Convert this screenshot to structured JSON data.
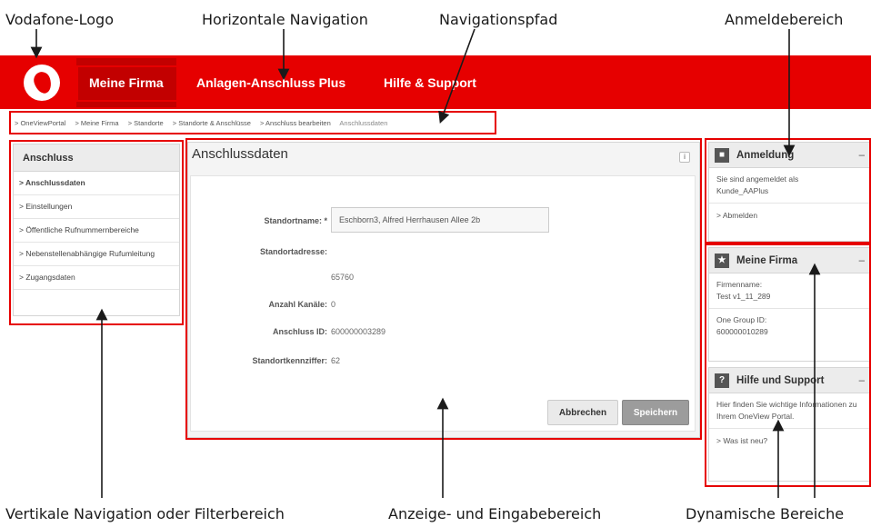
{
  "annotations": {
    "logo": "Vodafone-Logo",
    "horizontal_nav": "Horizontale Navigation",
    "breadcrumb": "Navigationspfad",
    "login_area": "Anmeldebereich",
    "vertical_nav": "Vertikale Navigation oder Filterbereich",
    "display_area": "Anzeige- und Eingabebereich",
    "dynamic_areas": "Dynamische Bereiche"
  },
  "header": {
    "nav": [
      "Meine Firma",
      "Anlagen-Anschluss Plus",
      "Hilfe & Support"
    ]
  },
  "breadcrumb": [
    "> OneViewPortal",
    "> Meine Firma",
    "> Standorte",
    "> Standorte & Anschlüsse",
    "> Anschluss bearbeiten",
    "Anschlussdaten"
  ],
  "sidebar": {
    "title": "Anschluss",
    "items": [
      "> Anschlussdaten",
      "> Einstellungen",
      "> Öffentliche Rufnummernbereiche",
      "> Nebenstellenabhängige Rufumleitung",
      "> Zugangsdaten"
    ]
  },
  "main": {
    "title": "Anschlussdaten",
    "info": "i",
    "fields": {
      "standortname_label": "Standortname: *",
      "standortname_value": "Eschborn3, Alfred Herrhausen Allee 2b",
      "standortadresse_label": "Standortadresse:",
      "plz_value": "65760",
      "kanaele_label": "Anzahl Kanäle:",
      "kanaele_value": "0",
      "anschluss_id_label": "Anschluss ID:",
      "anschluss_id_value": "600000003289",
      "kennziffer_label": "Standortkennziffer:",
      "kennziffer_value": "62"
    },
    "buttons": {
      "cancel": "Abbrechen",
      "save": "Speichern"
    }
  },
  "right": {
    "login": {
      "title": "Anmeldung",
      "text1": "Sie sind angemeldet als",
      "text2": "Kunde_AAPlus",
      "logout": "> Abmelden"
    },
    "company": {
      "title": "Meine Firma",
      "name_label": "Firmenname:",
      "name_value": "Test v1_11_289",
      "group_label": "One Group ID:",
      "group_value": "600000010289"
    },
    "help": {
      "title": "Hilfe und Support",
      "text": "Hier finden Sie wichtige Informationen zu Ihrem OneView Portal.",
      "link": "> Was ist neu?"
    },
    "collapse": "–"
  }
}
